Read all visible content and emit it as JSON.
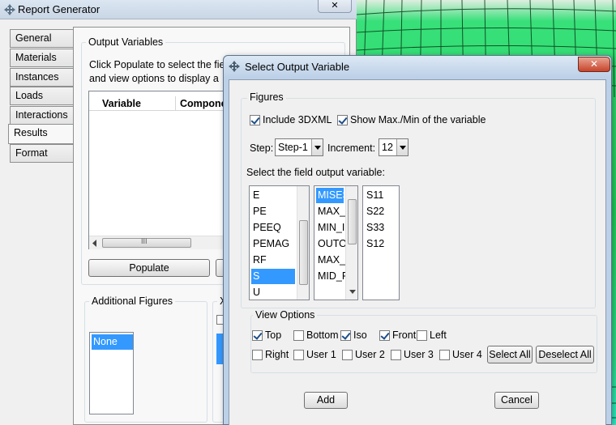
{
  "main_window": {
    "title": "Report Generator",
    "close_glyph": "✕",
    "tabs": [
      "General",
      "Materials",
      "Instances",
      "Loads",
      "Interactions",
      "Results",
      "Format"
    ],
    "active_tab": "Results",
    "output_variables": {
      "group_label": "Output Variables",
      "instruction_line1": "Click Populate to select the fie",
      "instruction_line2": "and view options to display a",
      "columns": [
        "Variable",
        "Compone"
      ],
      "scroll_grip": "III",
      "populate_label": "Populate"
    },
    "additional_figures": {
      "group_label": "Additional Figures",
      "items": [
        "None"
      ],
      "partial_label": "X"
    }
  },
  "dialog": {
    "title": "Select Output Variable",
    "close_glyph": "✕",
    "figures": {
      "group_label": "Figures",
      "include_3dxml": {
        "label": "Include 3DXML",
        "checked": true
      },
      "show_maxmin": {
        "label": "Show Max./Min of the variable",
        "checked": true
      },
      "step_label": "Step:",
      "step_value": "Step-1",
      "increment_label": "Increment:",
      "increment_value": "12",
      "field_output_label": "Select the field output variable:",
      "variables": [
        "E",
        "PE",
        "PEEQ",
        "PEMAG",
        "RF",
        "S",
        "U"
      ],
      "selected_variable": "S",
      "invariants": [
        "MISES",
        "MAX_I",
        "MIN_I",
        "OUTO",
        "MAX_I",
        "MID_F"
      ],
      "selected_invariant": "MISES",
      "components": [
        "S11",
        "S22",
        "S33",
        "S12"
      ]
    },
    "view_options": {
      "group_label": "View Options",
      "row1": [
        {
          "label": "Top",
          "checked": true
        },
        {
          "label": "Bottom",
          "checked": false
        },
        {
          "label": "Iso",
          "checked": true
        },
        {
          "label": "Front",
          "checked": true
        },
        {
          "label": "Left",
          "checked": false
        }
      ],
      "row2": [
        {
          "label": "Right",
          "checked": false
        },
        {
          "label": "User 1",
          "checked": false
        },
        {
          "label": "User 2",
          "checked": false
        },
        {
          "label": "User 3",
          "checked": false
        },
        {
          "label": "User 4",
          "checked": false
        }
      ],
      "select_all_label": "Select All",
      "deselect_all_label": "Deselect All"
    },
    "add_label": "Add",
    "cancel_label": "Cancel"
  },
  "colors": {
    "selection": "#3399ff",
    "mesh_green": "#1fd35a",
    "mesh_cyan": "#2ef0c8"
  }
}
